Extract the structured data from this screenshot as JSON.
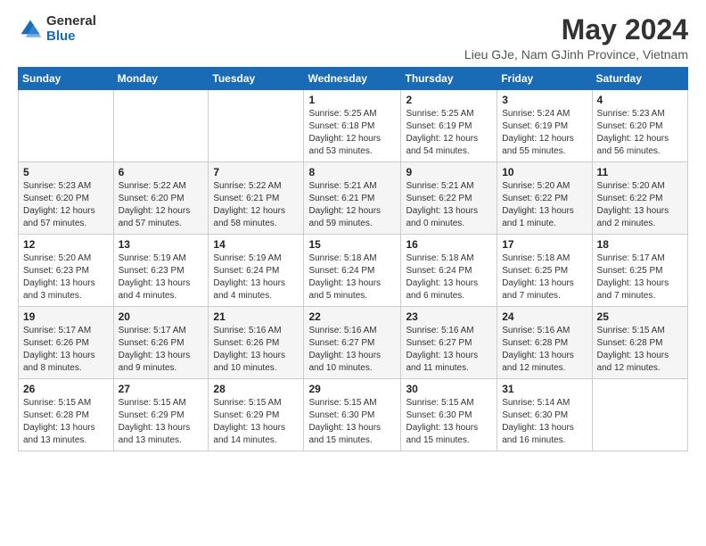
{
  "header": {
    "logo_general": "General",
    "logo_blue": "Blue",
    "title": "May 2024",
    "subtitle": "Lieu GJe, Nam GJinh Province, Vietnam"
  },
  "weekdays": [
    "Sunday",
    "Monday",
    "Tuesday",
    "Wednesday",
    "Thursday",
    "Friday",
    "Saturday"
  ],
  "weeks": [
    [
      {
        "day": "",
        "info": ""
      },
      {
        "day": "",
        "info": ""
      },
      {
        "day": "",
        "info": ""
      },
      {
        "day": "1",
        "info": "Sunrise: 5:25 AM\nSunset: 6:18 PM\nDaylight: 12 hours\nand 53 minutes."
      },
      {
        "day": "2",
        "info": "Sunrise: 5:25 AM\nSunset: 6:19 PM\nDaylight: 12 hours\nand 54 minutes."
      },
      {
        "day": "3",
        "info": "Sunrise: 5:24 AM\nSunset: 6:19 PM\nDaylight: 12 hours\nand 55 minutes."
      },
      {
        "day": "4",
        "info": "Sunrise: 5:23 AM\nSunset: 6:20 PM\nDaylight: 12 hours\nand 56 minutes."
      }
    ],
    [
      {
        "day": "5",
        "info": "Sunrise: 5:23 AM\nSunset: 6:20 PM\nDaylight: 12 hours\nand 57 minutes."
      },
      {
        "day": "6",
        "info": "Sunrise: 5:22 AM\nSunset: 6:20 PM\nDaylight: 12 hours\nand 57 minutes."
      },
      {
        "day": "7",
        "info": "Sunrise: 5:22 AM\nSunset: 6:21 PM\nDaylight: 12 hours\nand 58 minutes."
      },
      {
        "day": "8",
        "info": "Sunrise: 5:21 AM\nSunset: 6:21 PM\nDaylight: 12 hours\nand 59 minutes."
      },
      {
        "day": "9",
        "info": "Sunrise: 5:21 AM\nSunset: 6:22 PM\nDaylight: 13 hours\nand 0 minutes."
      },
      {
        "day": "10",
        "info": "Sunrise: 5:20 AM\nSunset: 6:22 PM\nDaylight: 13 hours\nand 1 minute."
      },
      {
        "day": "11",
        "info": "Sunrise: 5:20 AM\nSunset: 6:22 PM\nDaylight: 13 hours\nand 2 minutes."
      }
    ],
    [
      {
        "day": "12",
        "info": "Sunrise: 5:20 AM\nSunset: 6:23 PM\nDaylight: 13 hours\nand 3 minutes."
      },
      {
        "day": "13",
        "info": "Sunrise: 5:19 AM\nSunset: 6:23 PM\nDaylight: 13 hours\nand 4 minutes."
      },
      {
        "day": "14",
        "info": "Sunrise: 5:19 AM\nSunset: 6:24 PM\nDaylight: 13 hours\nand 4 minutes."
      },
      {
        "day": "15",
        "info": "Sunrise: 5:18 AM\nSunset: 6:24 PM\nDaylight: 13 hours\nand 5 minutes."
      },
      {
        "day": "16",
        "info": "Sunrise: 5:18 AM\nSunset: 6:24 PM\nDaylight: 13 hours\nand 6 minutes."
      },
      {
        "day": "17",
        "info": "Sunrise: 5:18 AM\nSunset: 6:25 PM\nDaylight: 13 hours\nand 7 minutes."
      },
      {
        "day": "18",
        "info": "Sunrise: 5:17 AM\nSunset: 6:25 PM\nDaylight: 13 hours\nand 7 minutes."
      }
    ],
    [
      {
        "day": "19",
        "info": "Sunrise: 5:17 AM\nSunset: 6:26 PM\nDaylight: 13 hours\nand 8 minutes."
      },
      {
        "day": "20",
        "info": "Sunrise: 5:17 AM\nSunset: 6:26 PM\nDaylight: 13 hours\nand 9 minutes."
      },
      {
        "day": "21",
        "info": "Sunrise: 5:16 AM\nSunset: 6:26 PM\nDaylight: 13 hours\nand 10 minutes."
      },
      {
        "day": "22",
        "info": "Sunrise: 5:16 AM\nSunset: 6:27 PM\nDaylight: 13 hours\nand 10 minutes."
      },
      {
        "day": "23",
        "info": "Sunrise: 5:16 AM\nSunset: 6:27 PM\nDaylight: 13 hours\nand 11 minutes."
      },
      {
        "day": "24",
        "info": "Sunrise: 5:16 AM\nSunset: 6:28 PM\nDaylight: 13 hours\nand 12 minutes."
      },
      {
        "day": "25",
        "info": "Sunrise: 5:15 AM\nSunset: 6:28 PM\nDaylight: 13 hours\nand 12 minutes."
      }
    ],
    [
      {
        "day": "26",
        "info": "Sunrise: 5:15 AM\nSunset: 6:28 PM\nDaylight: 13 hours\nand 13 minutes."
      },
      {
        "day": "27",
        "info": "Sunrise: 5:15 AM\nSunset: 6:29 PM\nDaylight: 13 hours\nand 13 minutes."
      },
      {
        "day": "28",
        "info": "Sunrise: 5:15 AM\nSunset: 6:29 PM\nDaylight: 13 hours\nand 14 minutes."
      },
      {
        "day": "29",
        "info": "Sunrise: 5:15 AM\nSunset: 6:30 PM\nDaylight: 13 hours\nand 15 minutes."
      },
      {
        "day": "30",
        "info": "Sunrise: 5:15 AM\nSunset: 6:30 PM\nDaylight: 13 hours\nand 15 minutes."
      },
      {
        "day": "31",
        "info": "Sunrise: 5:14 AM\nSunset: 6:30 PM\nDaylight: 13 hours\nand 16 minutes."
      },
      {
        "day": "",
        "info": ""
      }
    ]
  ]
}
